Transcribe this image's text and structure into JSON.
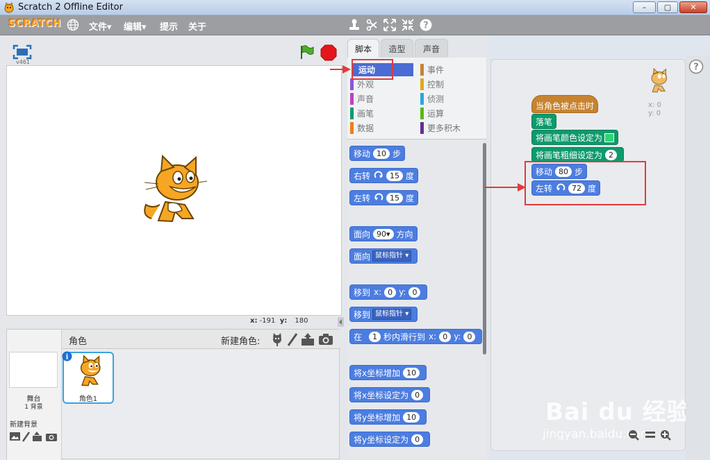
{
  "window": {
    "title": "Scratch 2 Offline Editor",
    "buttons": [
      "–",
      "▢",
      "✕"
    ]
  },
  "menubar": {
    "logo": "SCRATCH",
    "menus": [
      "文件▾",
      "编辑▾",
      "提示",
      "关于"
    ],
    "tools": [
      "duplicate-tool-icon",
      "delete-tool-icon",
      "grow-tool-icon",
      "shrink-tool-icon",
      "help-tool-icon"
    ]
  },
  "stage": {
    "version": "v461",
    "x_label": "x:",
    "x_value": "-191",
    "y_label": "y:",
    "y_value": "180"
  },
  "sprite_pane": {
    "title": "角色",
    "new_sprite_label": "新建角色:",
    "stage_label": "舞台",
    "backdrops_label": "1 背景",
    "new_backdrop_label": "新建背景",
    "sprite_name": "角色1"
  },
  "tabs": [
    "脚本",
    "造型",
    "声音"
  ],
  "categories": [
    {
      "label": "运动",
      "color": "#4a6cd4"
    },
    {
      "label": "事件",
      "color": "#c88330"
    },
    {
      "label": "外观",
      "color": "#8a55d7"
    },
    {
      "label": "控制",
      "color": "#e1a91a"
    },
    {
      "label": "声音",
      "color": "#bb42c3"
    },
    {
      "label": "侦测",
      "color": "#2ca5e2"
    },
    {
      "label": "画笔",
      "color": "#0e9a6c"
    },
    {
      "label": "运算",
      "color": "#5cb712"
    },
    {
      "label": "数据",
      "color": "#ee7d16"
    },
    {
      "label": "更多积木",
      "color": "#632d99"
    }
  ],
  "palette_blocks": {
    "move": {
      "pre": "移动",
      "num": "10",
      "post": "步"
    },
    "turn_right": {
      "pre": "右转",
      "num": "15",
      "post": "度"
    },
    "turn_left": {
      "pre": "左转",
      "num": "15",
      "post": "度"
    },
    "point_dir": {
      "pre": "面向",
      "num": "90▾",
      "post": "方向"
    },
    "point_towards": {
      "pre": "面向",
      "drop": "鼠标指针 ▾"
    },
    "goto_xy": {
      "pre": "移到",
      "x_label": "x:",
      "x": "0",
      "y_label": "y:",
      "y": "0"
    },
    "goto": {
      "pre": "移到",
      "drop": "鼠标指针 ▾"
    },
    "glide": {
      "pre": "在",
      "secs": "1",
      "mid": "秒内滑行到",
      "x_label": "x:",
      "x": "0",
      "y_label": "y:",
      "y": "0"
    },
    "change_x": {
      "pre": "将x坐标增加",
      "num": "10"
    },
    "set_x": {
      "pre": "将x坐标设定为",
      "num": "0"
    },
    "change_y": {
      "pre": "将y坐标增加",
      "num": "10"
    },
    "set_y": {
      "pre": "将y坐标设定为",
      "num": "0"
    }
  },
  "script": {
    "hat": "当角色被点击时",
    "pen_down": "落笔",
    "set_color": "将画笔颜色设定为",
    "pen_color": "#2ed573",
    "set_size": "将画笔粗细设定为",
    "size": "2",
    "move_pre": "移动",
    "move_num": "80",
    "move_post": "步",
    "turn_pre": "左转",
    "turn_num": "72",
    "turn_post": "度"
  },
  "sprite_info": {
    "x_label": "x:",
    "x": "0",
    "y_label": "y:",
    "y": "0"
  },
  "watermark": {
    "brand": "Bai du 经验",
    "url": "jingyan.baidu.com"
  }
}
